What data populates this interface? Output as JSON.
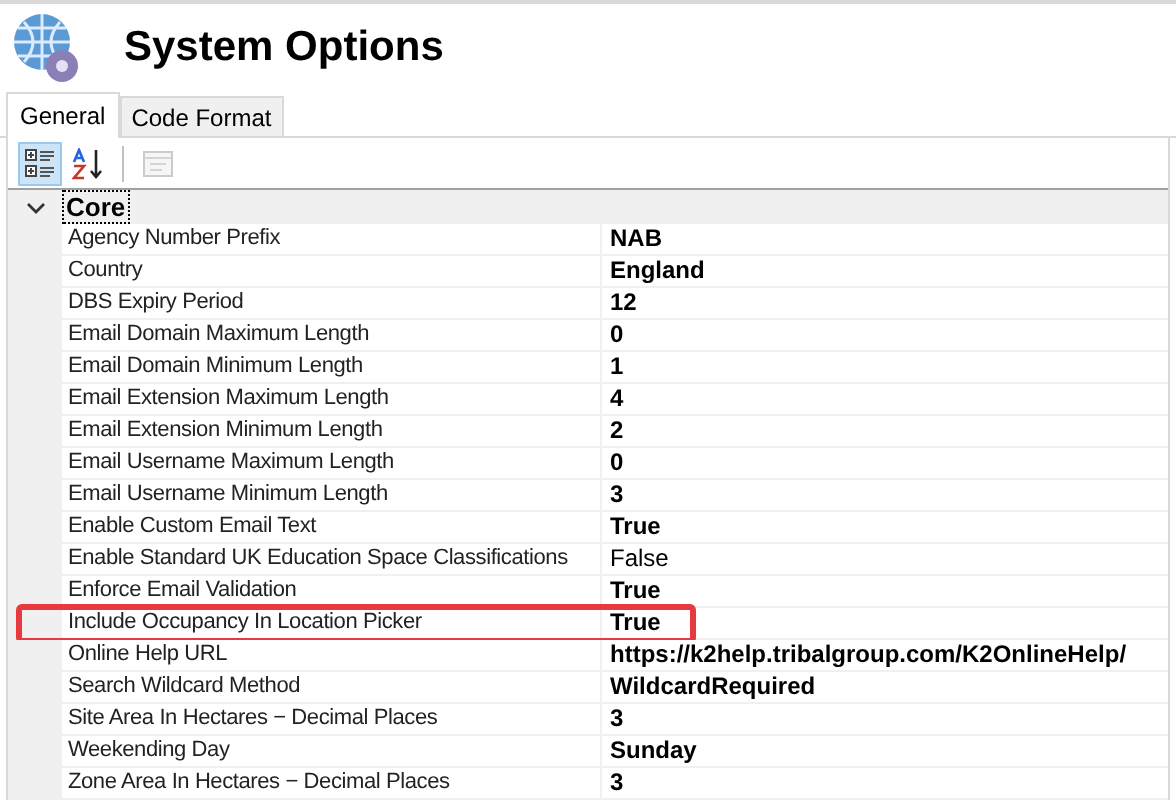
{
  "window": {
    "title": "System Options"
  },
  "tabs": [
    {
      "label": "General",
      "selected": true
    },
    {
      "label": "Code Format",
      "selected": false
    }
  ],
  "toolbar": [
    {
      "kind": "categorized",
      "selected": true,
      "disabled": false
    },
    {
      "kind": "alphabetical",
      "selected": false,
      "disabled": false
    },
    {
      "kind": "property_pages",
      "selected": false,
      "disabled": true
    }
  ],
  "category": {
    "name": "Core",
    "expanded": true,
    "properties": [
      {
        "name": "Agency Number Prefix",
        "value": "NAB",
        "modified": true,
        "highlighted": false
      },
      {
        "name": "Country",
        "value": "England",
        "modified": true,
        "highlighted": false
      },
      {
        "name": "DBS Expiry Period",
        "value": "12",
        "modified": true,
        "highlighted": false
      },
      {
        "name": "Email Domain Maximum Length",
        "value": "0",
        "modified": true,
        "highlighted": false
      },
      {
        "name": "Email Domain Minimum Length",
        "value": "1",
        "modified": true,
        "highlighted": false
      },
      {
        "name": "Email Extension Maximum Length",
        "value": "4",
        "modified": true,
        "highlighted": false
      },
      {
        "name": "Email Extension Minimum Length",
        "value": "2",
        "modified": true,
        "highlighted": false
      },
      {
        "name": "Email Username Maximum Length",
        "value": "0",
        "modified": true,
        "highlighted": false
      },
      {
        "name": "Email Username Minimum Length",
        "value": "3",
        "modified": true,
        "highlighted": false
      },
      {
        "name": "Enable Custom Email Text",
        "value": "True",
        "modified": true,
        "highlighted": false
      },
      {
        "name": "Enable Standard UK Education Space Classifications",
        "value": "False",
        "modified": false,
        "highlighted": false
      },
      {
        "name": "Enforce Email Validation",
        "value": "True",
        "modified": true,
        "highlighted": false
      },
      {
        "name": "Include Occupancy In Location Picker",
        "value": "True",
        "modified": true,
        "highlighted": true
      },
      {
        "name": "Online Help URL",
        "value": "https://k2help.tribalgroup.com/K2OnlineHelp/",
        "modified": true,
        "highlighted": false
      },
      {
        "name": "Search Wildcard Method",
        "value": "WildcardRequired",
        "modified": true,
        "highlighted": false
      },
      {
        "name": "Site Area In Hectares − Decimal Places",
        "value": "3",
        "modified": true,
        "highlighted": false
      },
      {
        "name": "Weekending Day",
        "value": "Sunday",
        "modified": true,
        "highlighted": false
      },
      {
        "name": "Zone Area In Hectares − Decimal Places",
        "value": "3",
        "modified": true,
        "highlighted": false
      }
    ]
  }
}
